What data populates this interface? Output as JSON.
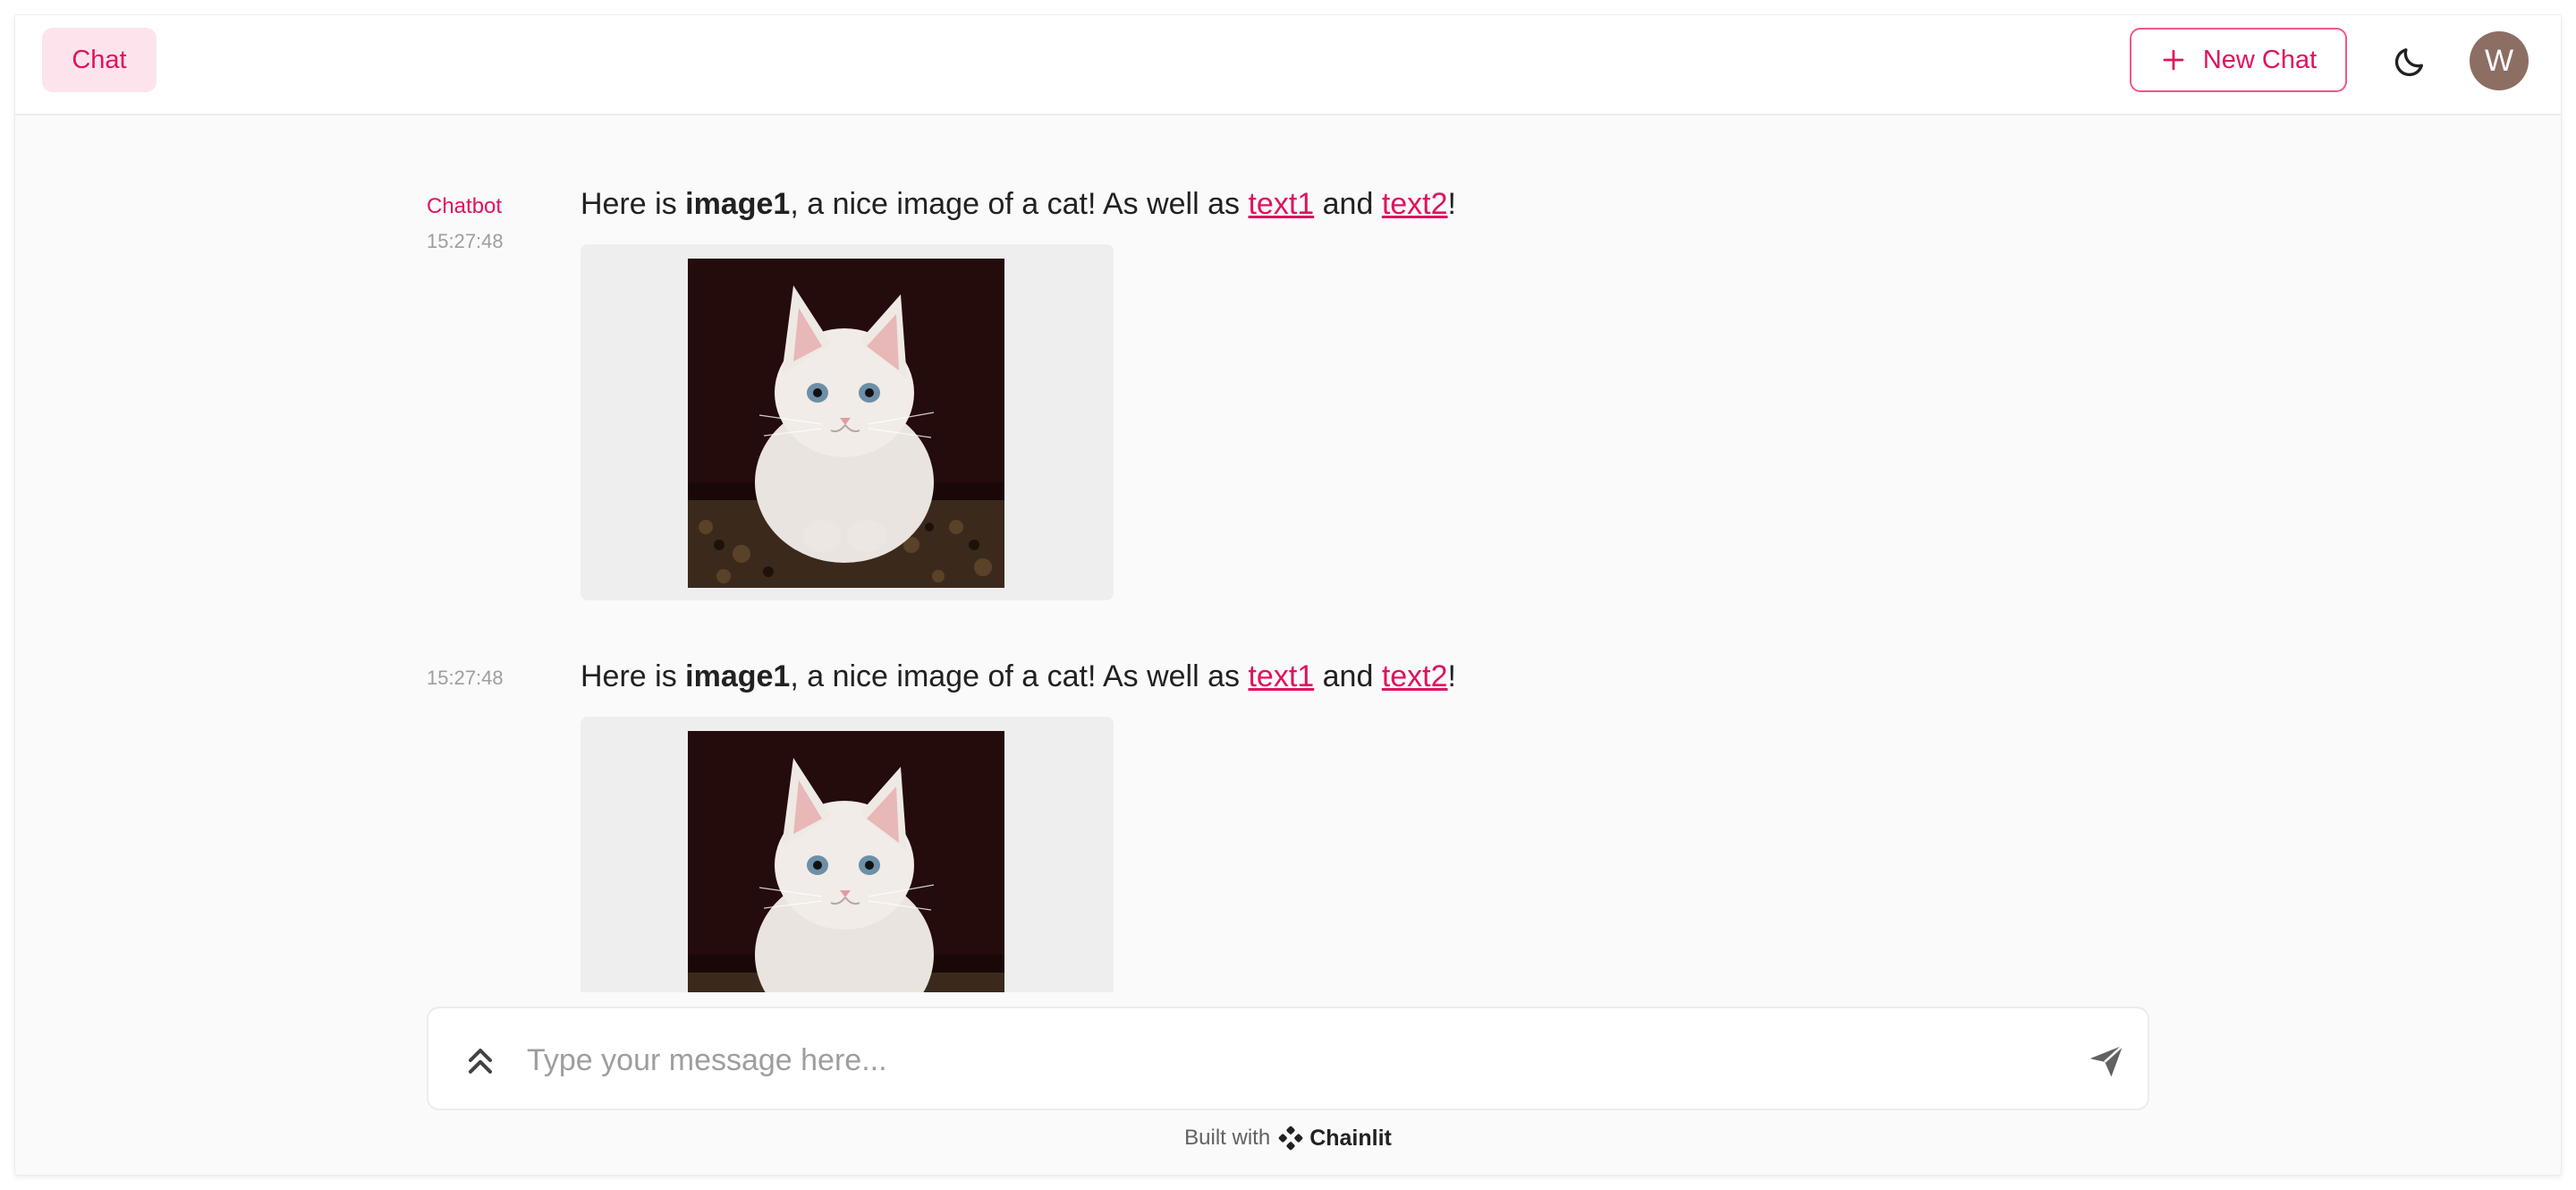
{
  "header": {
    "tab_label": "Chat",
    "new_chat_label": "New Chat",
    "avatar_initial": "W"
  },
  "messages": [
    {
      "author": "Chatbot",
      "time": "15:27:48",
      "text_prefix": "Here is ",
      "text_bold": "image1",
      "text_middle": ", a nice image of a cat! As well as ",
      "link1": "text1",
      "text_and": " and ",
      "link2": "text2",
      "text_suffix": "!",
      "image_alt": "cat"
    },
    {
      "author": "",
      "time": "15:27:48",
      "text_prefix": "Here is ",
      "text_bold": "image1",
      "text_middle": ", a nice image of a cat! As well as ",
      "link1": "text1",
      "text_and": " and ",
      "link2": "text2",
      "text_suffix": "!",
      "image_alt": "cat"
    }
  ],
  "composer": {
    "placeholder": "Type your message here..."
  },
  "footer": {
    "built_with": "Built with",
    "brand": "Chainlit"
  },
  "colors": {
    "accent": "#e0125f",
    "tab_bg": "#fde4ec",
    "avatar_bg": "#8d6e63"
  },
  "icons": [
    "plus-icon",
    "moon-icon",
    "chevrons-up-icon",
    "send-icon",
    "chainlit-logo-icon"
  ]
}
